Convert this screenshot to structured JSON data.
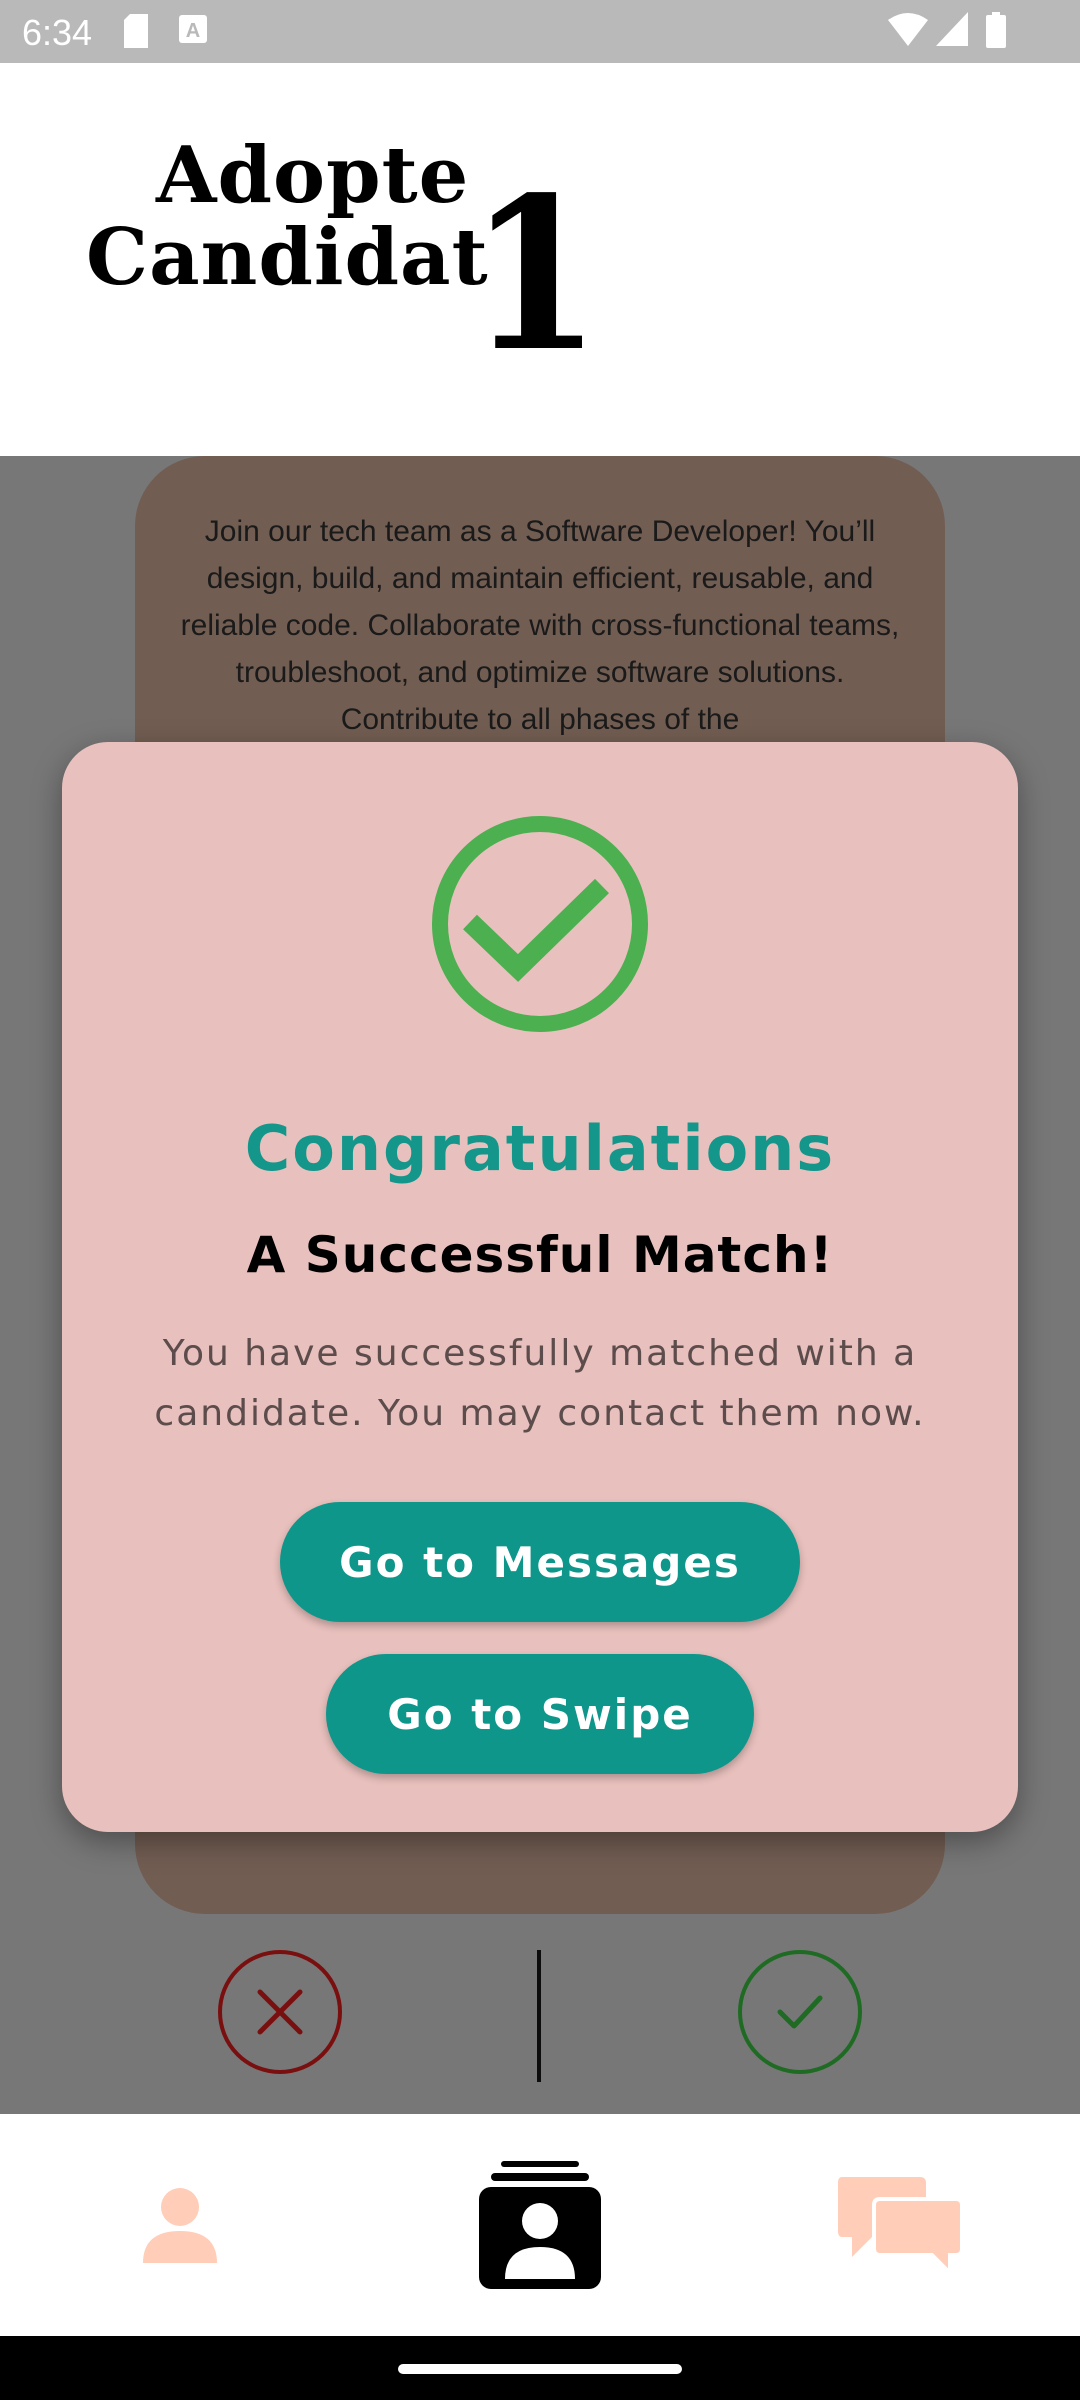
{
  "status_bar": {
    "time": "6:34",
    "icons": [
      "sd-card-icon",
      "font-download-icon",
      "wifi-icon",
      "signal-icon",
      "battery-icon"
    ]
  },
  "header": {
    "logo_line1": "Adopte",
    "logo_line2": "Candidat",
    "logo_number": "1"
  },
  "job_card": {
    "description": "Join our tech team as a Software Developer! You’ll design, build, and maintain efficient, reusable, and reliable code. Collaborate with cross-functional teams, troubleshoot, and optimize software solutions. Contribute to all phases of the"
  },
  "actions": {
    "reject_icon": "close-icon",
    "accept_icon": "check-icon"
  },
  "modal": {
    "icon": "check-circle-icon",
    "title": "Congratulations",
    "subtitle": "A Successful Match!",
    "message": "You have successfully matched with a candidate. You may contact them now.",
    "primary_button": "Go to Messages",
    "secondary_button": "Go to Swipe"
  },
  "bottom_nav": {
    "items": [
      {
        "icon": "person-icon",
        "active": false
      },
      {
        "icon": "cards-icon",
        "active": true
      },
      {
        "icon": "chat-bubbles-icon",
        "active": false
      }
    ]
  },
  "colors": {
    "accent": "#0e968b",
    "success_green": "#4caf50",
    "modal_bg": "#e8c0bd",
    "inactive_nav": "#ffcdb8"
  }
}
